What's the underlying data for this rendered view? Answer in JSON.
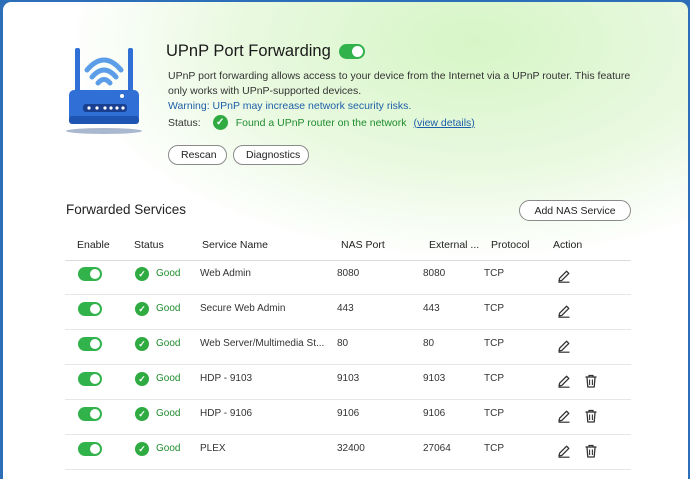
{
  "header": {
    "title": "UPnP Port Forwarding",
    "description": "UPnP port forwarding allows access to your device from the Internet via a UPnP router. This feature only works with UPnP-supported devices.",
    "warning": "Warning: UPnP may increase network security risks.",
    "status_label": "Status:",
    "status_text": "Found a UPnP router on the network",
    "view_details": "(view details)"
  },
  "actions": {
    "rescan": "Rescan",
    "diagnostics": "Diagnostics",
    "add_nas_service": "Add NAS Service"
  },
  "section": {
    "title": "Forwarded Services"
  },
  "table": {
    "headers": {
      "enable": "Enable",
      "status": "Status",
      "service_name": "Service Name",
      "nas_port": "NAS Port",
      "external": "External ...",
      "protocol": "Protocol",
      "action": "Action"
    },
    "rows": [
      {
        "status": "Good",
        "service": "Web Admin",
        "nas_port": "8080",
        "external": "8080",
        "protocol": "TCP"
      },
      {
        "status": "Good",
        "service": "Secure Web Admin",
        "nas_port": "443",
        "external": "443",
        "protocol": "TCP"
      },
      {
        "status": "Good",
        "service": "Web Server/Multimedia St...",
        "nas_port": "80",
        "external": "80",
        "protocol": "TCP"
      },
      {
        "status": "Good",
        "service": "HDP - 9103",
        "nas_port": "9103",
        "external": "9103",
        "protocol": "TCP"
      },
      {
        "status": "Good",
        "service": "HDP - 9106",
        "nas_port": "9106",
        "external": "9106",
        "protocol": "TCP"
      },
      {
        "status": "Good",
        "service": "PLEX",
        "nas_port": "32400",
        "external": "27064",
        "protocol": "TCP"
      }
    ]
  },
  "colors": {
    "accent_green": "#31b24b",
    "link_blue": "#1d5fa8",
    "router_blue": "#2f6fd6"
  },
  "icons": {
    "router": "router-icon",
    "check": "check-circle-icon",
    "edit": "edit-icon",
    "delete": "trash-icon"
  }
}
